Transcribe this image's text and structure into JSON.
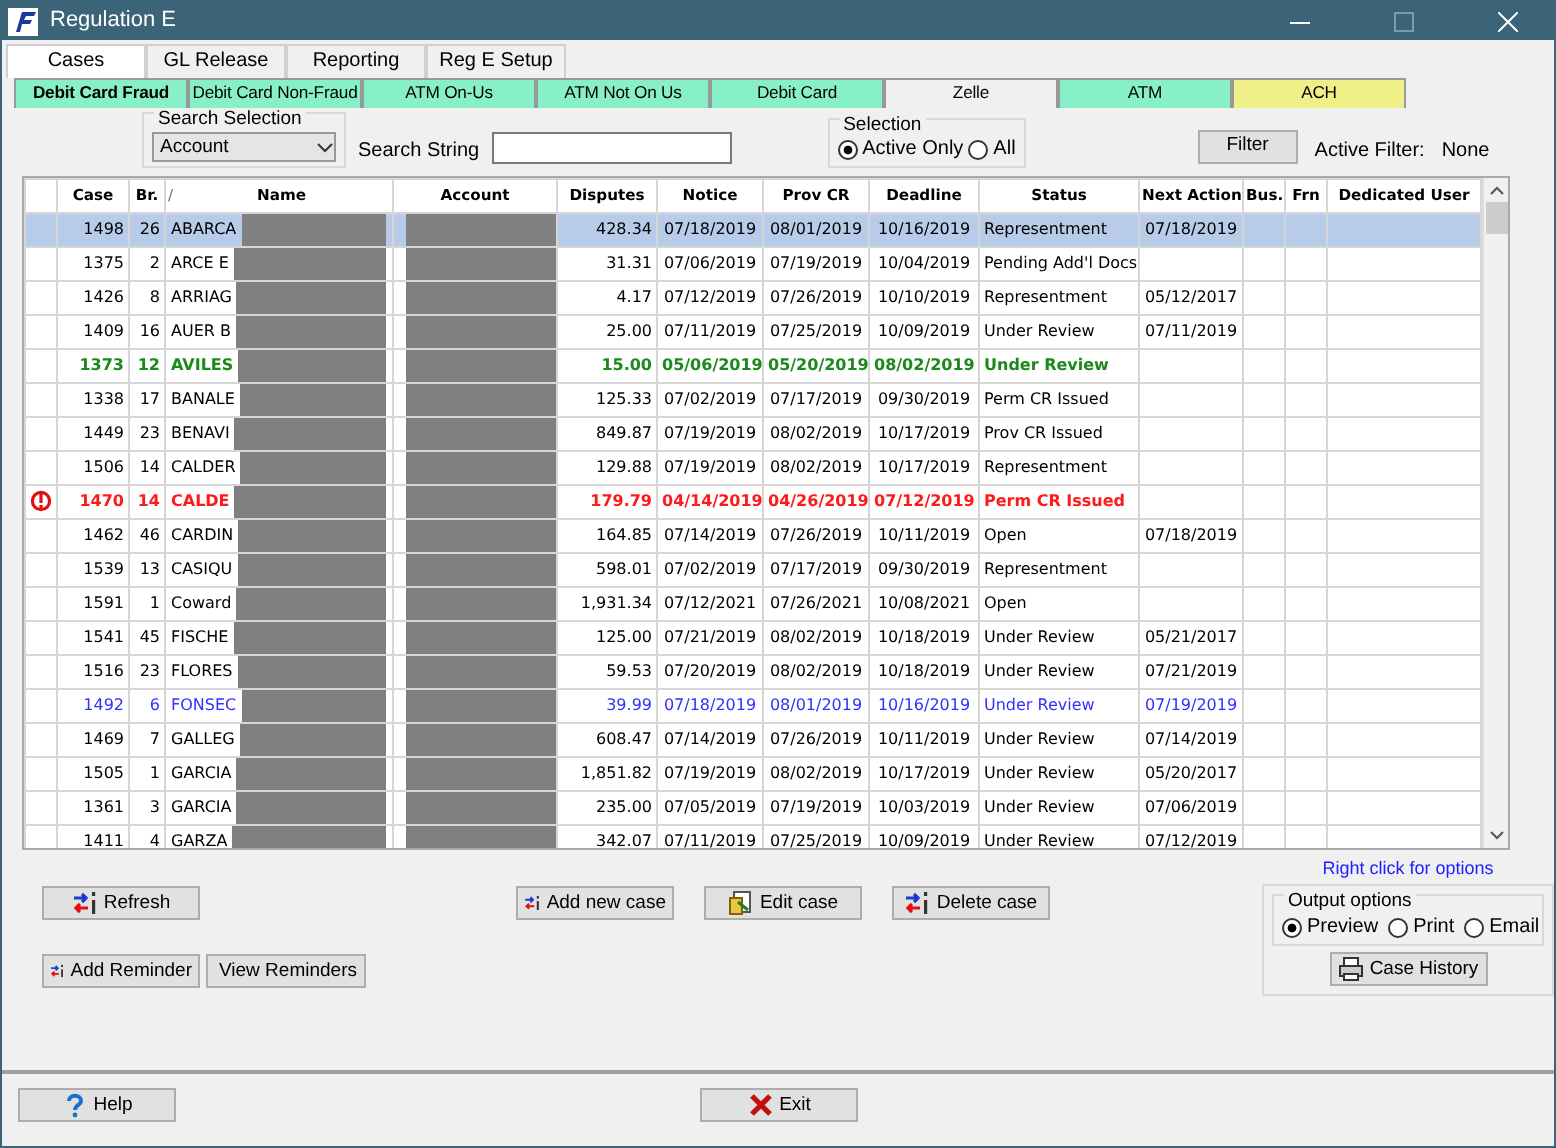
{
  "window": {
    "title": "Regulation E"
  },
  "tabs": [
    {
      "label": "Cases",
      "selected": true
    },
    {
      "label": "GL Release",
      "selected": false
    },
    {
      "label": "Reporting",
      "selected": false
    },
    {
      "label": "Reg E Setup",
      "selected": false
    }
  ],
  "subtabs": [
    {
      "label": "Debit Card Fraud",
      "selected": true,
      "color": "#88f0c8"
    },
    {
      "label": "Debit Card Non-Fraud",
      "selected": false,
      "color": "#88f0c8"
    },
    {
      "label": "ATM On-Us",
      "selected": false,
      "color": "#88f0c8"
    },
    {
      "label": "ATM Not On Us",
      "selected": false,
      "color": "#88f0c8"
    },
    {
      "label": "Debit Card",
      "selected": false,
      "color": "#88f0c8"
    },
    {
      "label": "Zelle",
      "selected": false,
      "color": "#f0f0f0"
    },
    {
      "label": "ATM",
      "selected": false,
      "color": "#88f0c8"
    },
    {
      "label": "ACH",
      "selected": false,
      "color": "#f0f088"
    }
  ],
  "search": {
    "group_label": "Search Selection",
    "selection": "Account",
    "string_label": "Search String"
  },
  "selection": {
    "label": "Selection",
    "options": [
      {
        "label": "Active Only",
        "selected": true
      },
      {
        "label": "All",
        "selected": false
      }
    ]
  },
  "filter": {
    "button": "Filter",
    "label": "Active Filter:",
    "value": "None"
  },
  "table": {
    "columns": [
      "Case",
      "Br.",
      "Name",
      "Account",
      "Disputes",
      "Notice",
      "Prov CR",
      "Deadline",
      "Status",
      "Next Action",
      "Bus.",
      "Frn",
      "Dedicated User"
    ],
    "sort_mark": "/",
    "rows": [
      {
        "kind": "normal",
        "selected": true,
        "alert": false,
        "case": "1498",
        "br": "26",
        "name": "ABARCA",
        "disputes": "428.34",
        "notice": "07/18/2019",
        "prov_cr": "08/01/2019",
        "deadline": "10/16/2019",
        "status": "Representment",
        "next_action": "07/18/2019"
      },
      {
        "kind": "normal",
        "selected": false,
        "alert": false,
        "case": "1375",
        "br": "2",
        "name": "ARCE E",
        "disputes": "31.31",
        "notice": "07/06/2019",
        "prov_cr": "07/19/2019",
        "deadline": "10/04/2019",
        "status": "Pending Add'l Docs"
      },
      {
        "kind": "normal",
        "selected": false,
        "alert": false,
        "case": "1426",
        "br": "8",
        "name": "ARRIAG",
        "disputes": "4.17",
        "notice": "07/12/2019",
        "prov_cr": "07/26/2019",
        "deadline": "10/10/2019",
        "status": "Representment",
        "next_action": "05/12/2017"
      },
      {
        "kind": "normal",
        "selected": false,
        "alert": false,
        "case": "1409",
        "br": "16",
        "name": "AUER B",
        "disputes": "25.00",
        "notice": "07/11/2019",
        "prov_cr": "07/25/2019",
        "deadline": "10/09/2019",
        "status": "Under Review",
        "next_action": "07/11/2019"
      },
      {
        "kind": "green",
        "selected": false,
        "alert": false,
        "case": "1373",
        "br": "12",
        "name": "AVILES",
        "disputes": "15.00",
        "notice": "05/06/2019",
        "prov_cr": "05/20/2019",
        "deadline": "08/02/2019",
        "status": "Under Review"
      },
      {
        "kind": "normal",
        "selected": false,
        "alert": false,
        "case": "1338",
        "br": "17",
        "name": "BANALE",
        "disputes": "125.33",
        "notice": "07/02/2019",
        "prov_cr": "07/17/2019",
        "deadline": "09/30/2019",
        "status": "Perm CR Issued"
      },
      {
        "kind": "normal",
        "selected": false,
        "alert": false,
        "case": "1449",
        "br": "23",
        "name": "BENAVI",
        "disputes": "849.87",
        "notice": "07/19/2019",
        "prov_cr": "08/02/2019",
        "deadline": "10/17/2019",
        "status": "Prov CR Issued"
      },
      {
        "kind": "normal",
        "selected": false,
        "alert": false,
        "case": "1506",
        "br": "14",
        "name": "CALDER",
        "disputes": "129.88",
        "notice": "07/19/2019",
        "prov_cr": "08/02/2019",
        "deadline": "10/17/2019",
        "status": "Representment"
      },
      {
        "kind": "red",
        "selected": false,
        "alert": true,
        "case": "1470",
        "br": "14",
        "name": "CALDE",
        "disputes": "179.79",
        "notice": "04/14/2019",
        "prov_cr": "04/26/2019",
        "deadline": "07/12/2019",
        "status": "Perm CR Issued"
      },
      {
        "kind": "normal",
        "selected": false,
        "alert": false,
        "case": "1462",
        "br": "46",
        "name": "CARDIN",
        "disputes": "164.85",
        "notice": "07/14/2019",
        "prov_cr": "07/26/2019",
        "deadline": "10/11/2019",
        "status": "Open",
        "next_action": "07/18/2019"
      },
      {
        "kind": "normal",
        "selected": false,
        "alert": false,
        "case": "1539",
        "br": "13",
        "name": "CASIQU",
        "disputes": "598.01",
        "notice": "07/02/2019",
        "prov_cr": "07/17/2019",
        "deadline": "09/30/2019",
        "status": "Representment"
      },
      {
        "kind": "normal",
        "selected": false,
        "alert": false,
        "case": "1591",
        "br": "1",
        "name": "Coward",
        "disputes": "1,931.34",
        "notice": "07/12/2021",
        "prov_cr": "07/26/2021",
        "deadline": "10/08/2021",
        "status": "Open"
      },
      {
        "kind": "normal",
        "selected": false,
        "alert": false,
        "case": "1541",
        "br": "45",
        "name": "FISCHE",
        "disputes": "125.00",
        "notice": "07/21/2019",
        "prov_cr": "08/02/2019",
        "deadline": "10/18/2019",
        "status": "Under Review",
        "next_action": "05/21/2017"
      },
      {
        "kind": "normal",
        "selected": false,
        "alert": false,
        "case": "1516",
        "br": "23",
        "name": "FLORES",
        "disputes": "59.53",
        "notice": "07/20/2019",
        "prov_cr": "08/02/2019",
        "deadline": "10/18/2019",
        "status": "Under Review",
        "next_action": "07/21/2019"
      },
      {
        "kind": "blue",
        "selected": false,
        "alert": false,
        "case": "1492",
        "br": "6",
        "name": "FONSEC",
        "disputes": "39.99",
        "notice": "07/18/2019",
        "prov_cr": "08/01/2019",
        "deadline": "10/16/2019",
        "status": "Under Review",
        "next_action": "07/19/2019"
      },
      {
        "kind": "normal",
        "selected": false,
        "alert": false,
        "case": "1469",
        "br": "7",
        "name": "GALLEG",
        "disputes": "608.47",
        "notice": "07/14/2019",
        "prov_cr": "07/26/2019",
        "deadline": "10/11/2019",
        "status": "Under Review",
        "next_action": "07/14/2019"
      },
      {
        "kind": "normal",
        "selected": false,
        "alert": false,
        "case": "1505",
        "br": "1",
        "name": "GARCIA",
        "disputes": "1,851.82",
        "notice": "07/19/2019",
        "prov_cr": "08/02/2019",
        "deadline": "10/17/2019",
        "status": "Under Review",
        "next_action": "05/20/2017"
      },
      {
        "kind": "normal",
        "selected": false,
        "alert": false,
        "case": "1361",
        "br": "3",
        "name": "GARCIA",
        "disputes": "235.00",
        "notice": "07/05/2019",
        "prov_cr": "07/19/2019",
        "deadline": "10/03/2019",
        "status": "Under Review",
        "next_action": "07/06/2019"
      },
      {
        "kind": "normal",
        "selected": false,
        "alert": false,
        "case": "1411",
        "br": "4",
        "name": "GARZA",
        "disputes": "342.07",
        "notice": "07/11/2019",
        "prov_cr": "07/25/2019",
        "deadline": "10/09/2019",
        "status": "Under Review",
        "next_action": "07/12/2019"
      }
    ]
  },
  "hint": "Right click for options",
  "actions": [
    "Refresh",
    "Add new case",
    "Edit case",
    "Delete case"
  ],
  "reminders": [
    "Add Reminder",
    "View Reminders"
  ],
  "output": {
    "label": "Output options",
    "options": [
      {
        "label": "Preview",
        "selected": true
      },
      {
        "label": "Print",
        "selected": false
      },
      {
        "label": "Email",
        "selected": false
      }
    ],
    "button": "Case History"
  },
  "footer": [
    "Help",
    "Exit"
  ]
}
